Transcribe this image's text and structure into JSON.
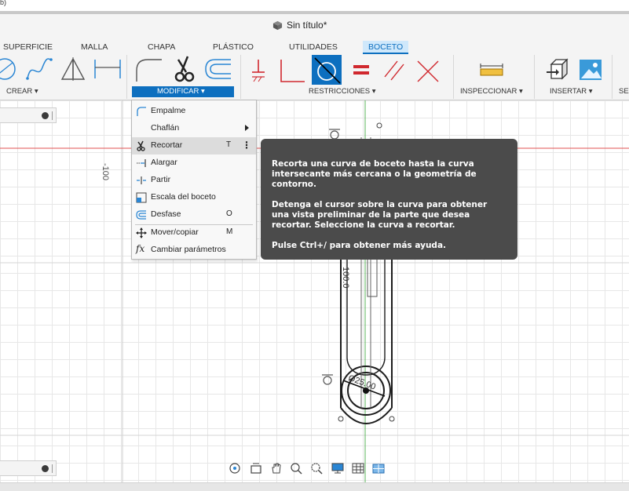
{
  "corner_tag": "b)",
  "window": {
    "title": "Sin título*"
  },
  "tabs": [
    {
      "label": "SUPERFICIE",
      "active": false
    },
    {
      "label": "MALLA",
      "active": false
    },
    {
      "label": "CHAPA",
      "active": false
    },
    {
      "label": "PLÁSTICO",
      "active": false
    },
    {
      "label": "UTILIDADES",
      "active": false
    },
    {
      "label": "BOCETO",
      "active": true
    }
  ],
  "groups": {
    "crear": "CREAR ▾",
    "modificar": "MODIFICAR ▾",
    "restricciones": "RESTRICCIONES ▾",
    "inspeccionar": "INSPECCIONAR ▾",
    "insertar": "INSERTAR ▾",
    "cut": "SE"
  },
  "canvas": {
    "ruler_label": "-100",
    "dimension_label": "100.0",
    "diameter_label": "Ø25.00"
  },
  "modify_menu": {
    "items": [
      {
        "label": "Empalme",
        "icon": "fillet-icon",
        "shortcut": ""
      },
      {
        "label": "Chaflán",
        "icon": "chamfer-icon",
        "shortcut": "",
        "submenu": true
      },
      {
        "label": "Recortar",
        "icon": "trim-scissors-icon",
        "shortcut": "T",
        "highlighted": true,
        "options": "⋮"
      },
      {
        "label": "Alargar",
        "icon": "extend-icon",
        "shortcut": ""
      },
      {
        "label": "Partir",
        "icon": "break-icon",
        "shortcut": ""
      },
      {
        "label": "Escala del boceto",
        "icon": "sketch-scale-icon",
        "shortcut": ""
      },
      {
        "label": "Desfase",
        "icon": "offset-icon",
        "shortcut": "O"
      },
      {
        "label": "Mover/copiar",
        "icon": "move-copy-icon",
        "shortcut": "M"
      },
      {
        "label": "Cambiar parámetros",
        "icon": "parameters-fx-icon",
        "shortcut": ""
      }
    ]
  },
  "tooltip": {
    "p1": "Recorta una curva de boceto hasta la curva intersecante más cercana o la geometría de contorno.",
    "p2": "Detenga el cursor sobre la curva para obtener una vista preliminar de la parte que desea recortar. Seleccione la curva a recortar.",
    "p3": "Pulse Ctrl+/ para obtener más ayuda."
  },
  "colors": {
    "accent": "#0d6fbf",
    "tab_active_bg": "#cfe8fb",
    "constraint_red": "#d0282e",
    "axis_red": "#e05050",
    "axis_green": "#5ab35a",
    "tooltip_bg": "#4b4b4b"
  }
}
